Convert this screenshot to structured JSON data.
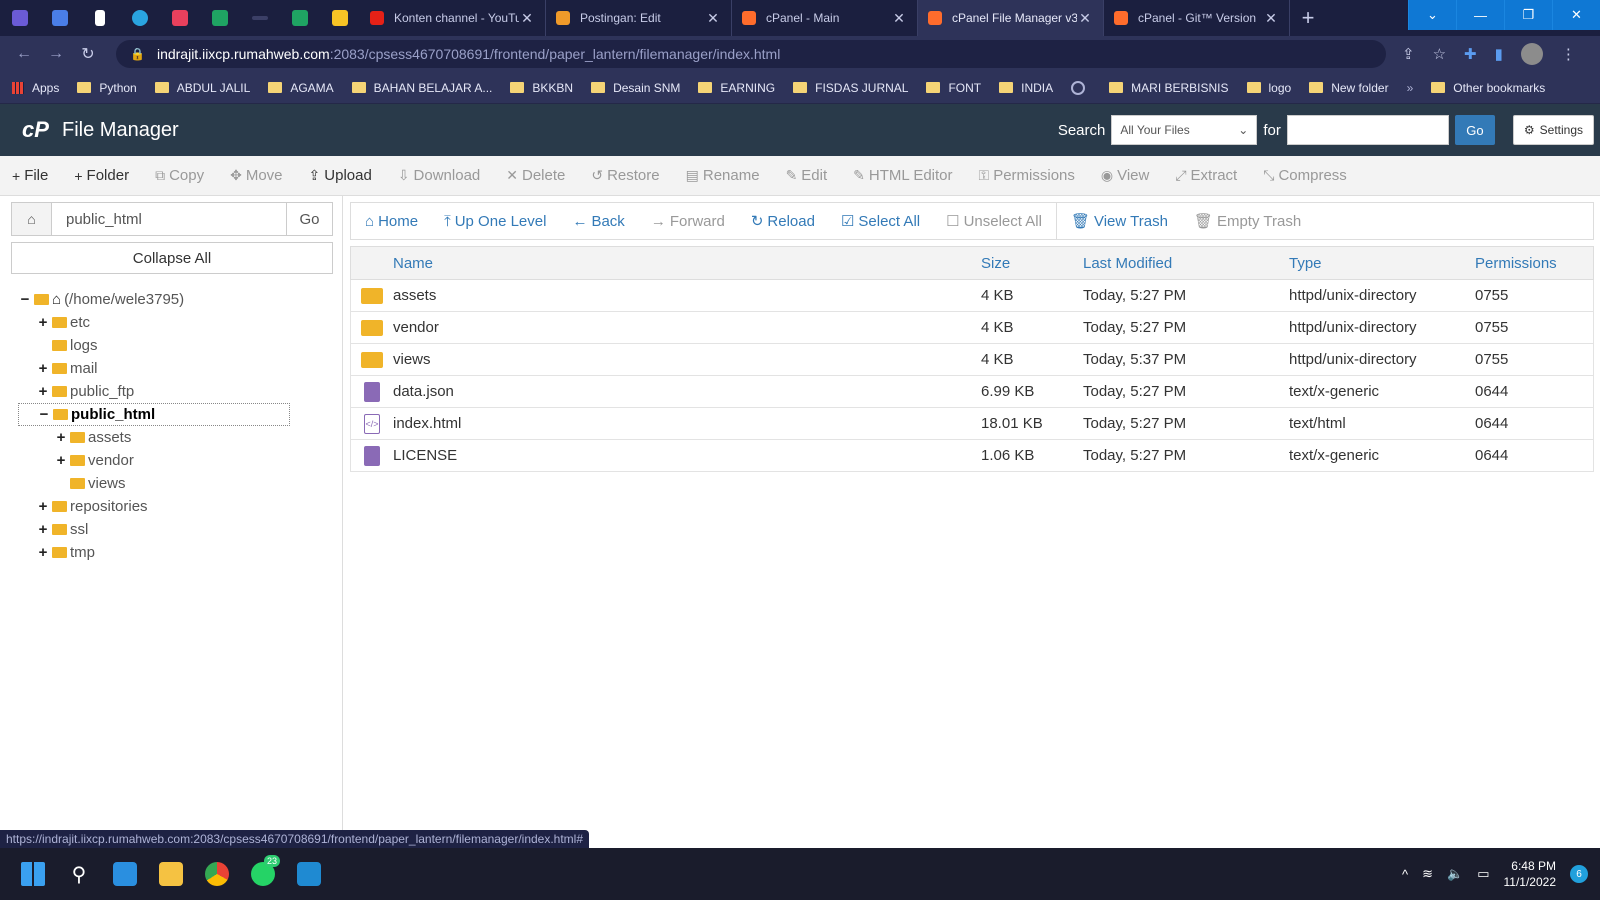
{
  "browser": {
    "tabs": [
      {
        "title": "Konten channel - YouTube",
        "fav": "#e62117",
        "active": false
      },
      {
        "title": "Postingan: Edit",
        "fav": "#f09a2a",
        "active": false
      },
      {
        "title": "cPanel - Main",
        "fav": "#ff6c2c",
        "active": false
      },
      {
        "title": "cPanel File Manager v3",
        "fav": "#ff6c2c",
        "active": true
      },
      {
        "title": "cPanel - Git™ Version",
        "fav": "#ff6c2c",
        "active": false
      }
    ],
    "url_host": "indrajit.iixcp.rumahweb.com",
    "url_rest": ":2083/cpsess4670708691/frontend/paper_lantern/filemanager/index.html",
    "bookmarks": [
      {
        "label": "Apps",
        "kind": "grid"
      },
      {
        "label": "Python",
        "kind": "folder"
      },
      {
        "label": "ABDUL JALIL",
        "kind": "folder"
      },
      {
        "label": "AGAMA",
        "kind": "folder"
      },
      {
        "label": "BAHAN BELAJAR A...",
        "kind": "folder"
      },
      {
        "label": "BKKBN",
        "kind": "folder"
      },
      {
        "label": "Desain SNM",
        "kind": "folder"
      },
      {
        "label": "EARNING",
        "kind": "folder"
      },
      {
        "label": "FISDAS JURNAL",
        "kind": "folder"
      },
      {
        "label": "FONT",
        "kind": "folder"
      },
      {
        "label": "INDIA",
        "kind": "folder"
      },
      {
        "label": "",
        "kind": "globe"
      },
      {
        "label": "MARI BERBISNIS",
        "kind": "folder"
      },
      {
        "label": "logo",
        "kind": "folder"
      },
      {
        "label": "New folder",
        "kind": "folder"
      }
    ],
    "other_bookmarks": "Other bookmarks",
    "status_url": "https://indrajit.iixcp.rumahweb.com:2083/cpsess4670708691/frontend/paper_lantern/filemanager/index.html#"
  },
  "header": {
    "logo": "cP",
    "title": "File Manager",
    "search_label": "Search",
    "search_scope": "All Your Files",
    "for_label": "for",
    "go_label": "Go",
    "settings_label": "Settings"
  },
  "toolbar": [
    {
      "icon": "+",
      "label": "File",
      "enabled": true,
      "name": "new-file-button"
    },
    {
      "icon": "+",
      "label": "Folder",
      "enabled": true,
      "name": "new-folder-button"
    },
    {
      "icon": "⧉",
      "label": "Copy",
      "enabled": false,
      "name": "copy-button"
    },
    {
      "icon": "✥",
      "label": "Move",
      "enabled": false,
      "name": "move-button"
    },
    {
      "icon": "⇪",
      "label": "Upload",
      "enabled": true,
      "name": "upload-button"
    },
    {
      "icon": "⇩",
      "label": "Download",
      "enabled": false,
      "name": "download-button"
    },
    {
      "icon": "✕",
      "label": "Delete",
      "enabled": false,
      "name": "delete-button"
    },
    {
      "icon": "↺",
      "label": "Restore",
      "enabled": false,
      "name": "restore-button"
    },
    {
      "icon": "▤",
      "label": "Rename",
      "enabled": false,
      "name": "rename-button"
    },
    {
      "icon": "✎",
      "label": "Edit",
      "enabled": false,
      "name": "edit-button"
    },
    {
      "icon": "✎",
      "label": "HTML Editor",
      "enabled": false,
      "name": "html-editor-button"
    },
    {
      "icon": "⚿",
      "label": "Permissions",
      "enabled": false,
      "name": "permissions-button"
    },
    {
      "icon": "◉",
      "label": "View",
      "enabled": false,
      "name": "view-button"
    },
    {
      "icon": "⤢",
      "label": "Extract",
      "enabled": false,
      "name": "extract-button"
    },
    {
      "icon": "⤡",
      "label": "Compress",
      "enabled": false,
      "name": "compress-button"
    }
  ],
  "sidebar": {
    "path_value": "public_html",
    "go_label": "Go",
    "collapse_label": "Collapse All",
    "tree": [
      {
        "label": "(/home/wele3795)",
        "toggle": "−",
        "depth": 0,
        "home": true
      },
      {
        "label": "etc",
        "toggle": "+",
        "depth": 1
      },
      {
        "label": "logs",
        "toggle": "",
        "depth": 1
      },
      {
        "label": "mail",
        "toggle": "+",
        "depth": 1
      },
      {
        "label": "public_ftp",
        "toggle": "+",
        "depth": 1
      },
      {
        "label": "public_html",
        "toggle": "−",
        "depth": 1,
        "selected": true
      },
      {
        "label": "assets",
        "toggle": "+",
        "depth": 2
      },
      {
        "label": "vendor",
        "toggle": "+",
        "depth": 2
      },
      {
        "label": "views",
        "toggle": "",
        "depth": 2
      },
      {
        "label": "repositories",
        "toggle": "+",
        "depth": 1
      },
      {
        "label": "ssl",
        "toggle": "+",
        "depth": 1
      },
      {
        "label": "tmp",
        "toggle": "+",
        "depth": 1
      }
    ]
  },
  "navbar": [
    {
      "icon": "⌂",
      "label": "Home",
      "enabled": true,
      "name": "home-nav-button"
    },
    {
      "icon": "⤒",
      "label": "Up One Level",
      "enabled": true,
      "name": "up-level-button"
    },
    {
      "icon": "←",
      "label": "Back",
      "enabled": true,
      "name": "back-button"
    },
    {
      "icon": "→",
      "label": "Forward",
      "enabled": false,
      "name": "forward-button"
    },
    {
      "icon": "↻",
      "label": "Reload",
      "enabled": true,
      "name": "reload-button"
    },
    {
      "icon": "☑",
      "label": "Select All",
      "enabled": true,
      "name": "select-all-button"
    },
    {
      "icon": "☐",
      "label": "Unselect All",
      "enabled": false,
      "name": "unselect-all-button"
    },
    {
      "icon": "🗑",
      "label": "View Trash",
      "enabled": true,
      "name": "view-trash-button"
    },
    {
      "icon": "🗑",
      "label": "Empty Trash",
      "enabled": false,
      "name": "empty-trash-button"
    }
  ],
  "table": {
    "headers": {
      "name": "Name",
      "size": "Size",
      "modified": "Last Modified",
      "type": "Type",
      "perms": "Permissions"
    },
    "rows": [
      {
        "kind": "folder",
        "name": "assets",
        "size": "4 KB",
        "modified": "Today, 5:27 PM",
        "type": "httpd/unix-directory",
        "perms": "0755"
      },
      {
        "kind": "folder",
        "name": "vendor",
        "size": "4 KB",
        "modified": "Today, 5:27 PM",
        "type": "httpd/unix-directory",
        "perms": "0755"
      },
      {
        "kind": "folder",
        "name": "views",
        "size": "4 KB",
        "modified": "Today, 5:37 PM",
        "type": "httpd/unix-directory",
        "perms": "0755"
      },
      {
        "kind": "doc",
        "name": "data.json",
        "size": "6.99 KB",
        "modified": "Today, 5:27 PM",
        "type": "text/x-generic",
        "perms": "0644"
      },
      {
        "kind": "html",
        "name": "index.html",
        "size": "18.01 KB",
        "modified": "Today, 5:27 PM",
        "type": "text/html",
        "perms": "0644"
      },
      {
        "kind": "doc",
        "name": "LICENSE",
        "size": "1.06 KB",
        "modified": "Today, 5:27 PM",
        "type": "text/x-generic",
        "perms": "0644"
      }
    ]
  },
  "taskbar": {
    "whatsapp_badge": "23",
    "time": "6:48 PM",
    "date": "11/1/2022",
    "notifications": "6"
  },
  "colors": {
    "accent": "#337ab7",
    "header_bg": "#293a4a",
    "folder": "#f0b429"
  }
}
